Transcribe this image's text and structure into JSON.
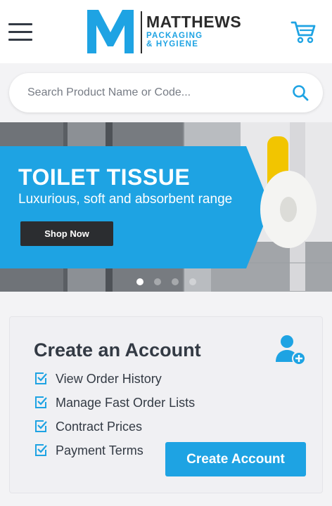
{
  "header": {
    "logo": {
      "letter": "M",
      "name": "MATTHEWS",
      "line1": "PACKAGING",
      "line2": "& HYGIENE"
    },
    "menu_icon": "hamburger-menu-icon",
    "cart_icon": "shopping-cart-icon"
  },
  "search": {
    "placeholder": "Search Product Name or Code...",
    "value": "",
    "icon": "search-icon"
  },
  "banner": {
    "title": "TOILET TISSUE",
    "subtitle": "Luxurious, soft and absorbent range",
    "button_label": "Shop Now",
    "slide_count": 4,
    "active_slide": 1
  },
  "account": {
    "title": "Create an Account",
    "benefits": [
      "View Order History",
      "Manage Fast Order Lists",
      "Contract Prices",
      "Payment Terms"
    ],
    "button_label": "Create Account",
    "icon": "add-user-icon"
  },
  "colors": {
    "brand_blue": "#1ea3e3",
    "dark_text": "#333a44",
    "dark_button": "#2b2d30"
  }
}
